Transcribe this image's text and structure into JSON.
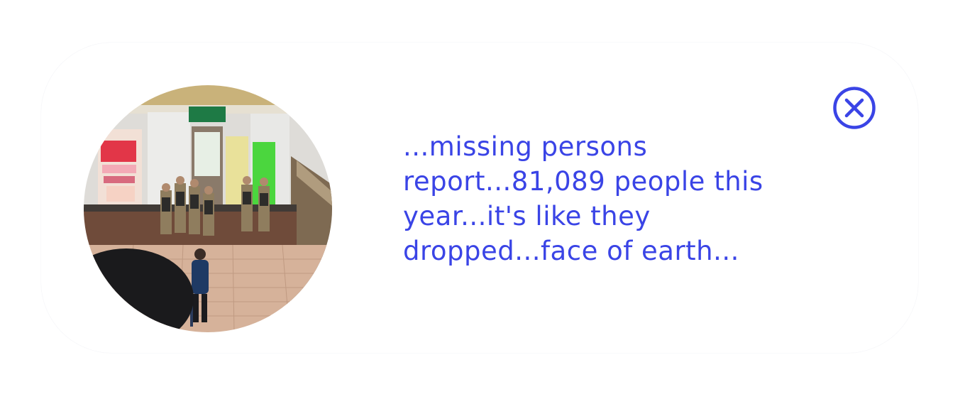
{
  "notification": {
    "message_lines": [
      "...missing persons",
      "report...81,089 people this",
      "year...it's like they",
      "dropped...face of earth..."
    ],
    "accent_color": "#3a44e6",
    "close_icon": "circle-x-icon",
    "photo": "station-concourse-with-soldiers"
  }
}
